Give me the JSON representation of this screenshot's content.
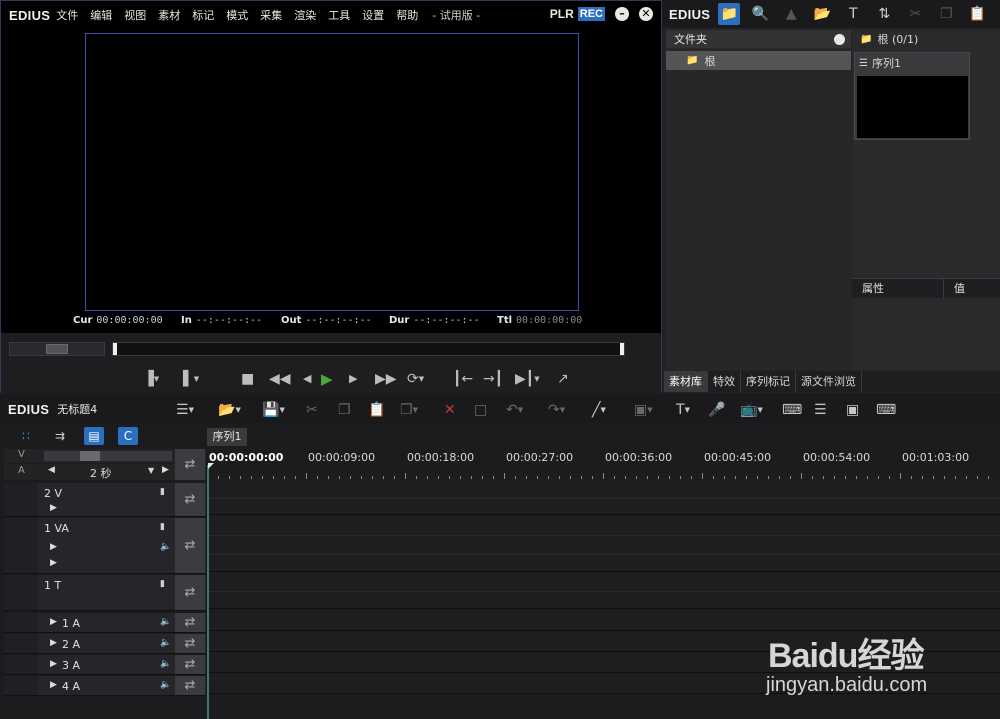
{
  "player": {
    "logo": "EDIUS",
    "menu": [
      "文件",
      "编辑",
      "视图",
      "素材",
      "标记",
      "模式",
      "采集",
      "渲染",
      "工具",
      "设置",
      "帮助"
    ],
    "title": "- 试用版 -",
    "plr_label": "PLR",
    "rec_label": "REC",
    "minimize_glyph": "–",
    "close_glyph": "✕",
    "timecodes": {
      "cur_label": "Cur",
      "cur": "00:00:00:00",
      "in_label": "In",
      "in": "--:--:--:--",
      "out_label": "Out",
      "out": "--:--:--:--",
      "dur_label": "Dur",
      "dur": "--:--:--:--",
      "ttl_label": "Ttl",
      "ttl": "00:00:00:00"
    }
  },
  "bin": {
    "logo": "EDIUS",
    "folder_header": "文件夹",
    "folder_root": "根",
    "clip_header": "根 (0/1)",
    "clip_name": "序列1",
    "props_col1": "属性",
    "props_col2": "值",
    "tabs": [
      "素材库",
      "特效",
      "序列标记",
      "源文件浏览"
    ]
  },
  "timeline": {
    "logo": "EDIUS",
    "project": "无标题4",
    "sequence_tab": "序列1",
    "v_label": "V",
    "a_label": "A",
    "scale": "2 秒",
    "ruler": [
      "00:00:00:00",
      "00:00:09:00",
      "00:00:18:00",
      "00:00:27:00",
      "00:00:36:00",
      "00:00:45:00",
      "00:00:54:00",
      "00:01:03:00"
    ],
    "tracks": [
      {
        "name": "2 V"
      },
      {
        "name": "1 VA"
      },
      {
        "name": "1 T"
      },
      {
        "name": "1 A"
      },
      {
        "name": "2 A"
      },
      {
        "name": "3 A"
      },
      {
        "name": "4 A"
      }
    ]
  },
  "watermark": {
    "brand": "Baidu经验",
    "url": "jingyan.baidu.com"
  },
  "colors": {
    "accent_blue": "#2a6fc0",
    "play_green": "#4da83c",
    "monitor_border": "#3d4fae",
    "playhead": "#2f7f6a"
  }
}
